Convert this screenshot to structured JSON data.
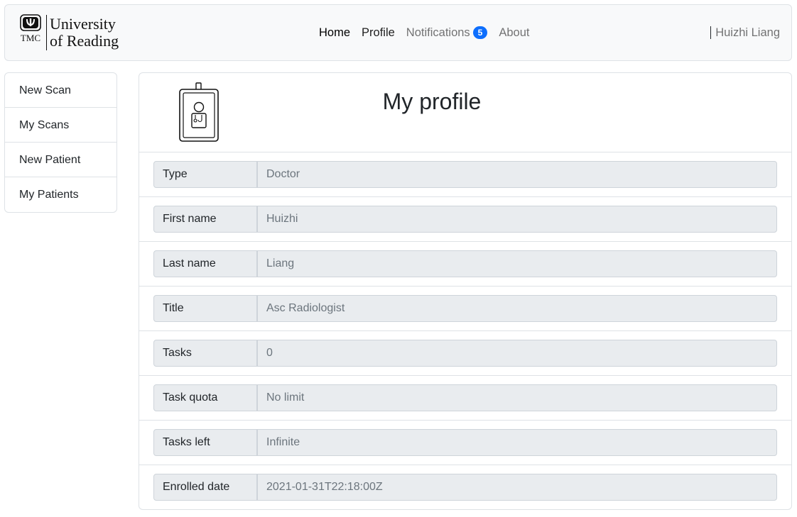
{
  "brand": {
    "logo_text": "TMC",
    "name_line1": "University",
    "name_line2": "of Reading"
  },
  "nav": {
    "home": "Home",
    "profile": "Profile",
    "notifications": "Notifications",
    "notifications_count": "5",
    "about": "About",
    "user": "Huizhi Liang"
  },
  "sidebar": {
    "items": [
      {
        "label": "New Scan"
      },
      {
        "label": "My Scans"
      },
      {
        "label": "New Patient"
      },
      {
        "label": "My Patients"
      }
    ]
  },
  "profile": {
    "title": "My profile",
    "icon": "id-badge-doctor-icon",
    "fields": [
      {
        "label": "Type",
        "value": "Doctor"
      },
      {
        "label": "First name",
        "value": "Huizhi"
      },
      {
        "label": "Last name",
        "value": "Liang"
      },
      {
        "label": "Title",
        "value": "Asc Radiologist"
      },
      {
        "label": "Tasks",
        "value": "0"
      },
      {
        "label": "Task quota",
        "value": "No limit"
      },
      {
        "label": "Tasks left",
        "value": "Infinite"
      },
      {
        "label": "Enrolled date",
        "value": "2021-01-31T22:18:00Z"
      }
    ]
  },
  "colors": {
    "accent": "#0d6efd",
    "navbar_bg": "#f8f9fa",
    "field_bg": "#e9ecef",
    "border": "#dee2e6"
  }
}
